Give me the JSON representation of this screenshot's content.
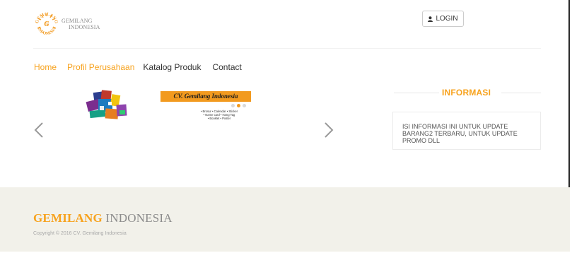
{
  "header": {
    "logo": {
      "name_line1": "GEMILANG",
      "name_line2": "INDONESIA",
      "emblem_text_top": "GEMILANG",
      "emblem_text_bottom": "INDONESIA",
      "emblem_monogram": "G"
    },
    "login_label": "LOGIN",
    "login_icon": "user-icon"
  },
  "nav": {
    "items": [
      {
        "label": "Home",
        "active": true
      },
      {
        "label": "Profil Perusahaan",
        "active": true
      },
      {
        "label": "Katalog Produk",
        "active": false
      },
      {
        "label": "Contact",
        "active": false
      }
    ]
  },
  "carousel": {
    "slide": {
      "banner_text": "CV. Gemilang Indonesia",
      "dots_total": 3,
      "active_dot": 2,
      "products": [
        "• Brosur  • Calendar  • Sticker",
        "• Name card  • Hang Tag",
        "• Booklet  • Poster"
      ]
    },
    "prev_icon": "chevron-left-icon",
    "next_icon": "chevron-right-icon"
  },
  "informasi": {
    "title": "INFORMASI",
    "text": "ISI INFORMASI INI UNTUK UPDATE BARANG2 TERBARU, UNTUK UPDATE PROMO DLL"
  },
  "footer": {
    "brand_part1": "GEMILANG",
    "brand_part2": "INDONESIA",
    "copyright": "Copyright © 2016 CV. Gemilang Indonesia"
  },
  "colors": {
    "accent": "#f7a21d",
    "footer_bg": "#f2f1ea",
    "text": "#333333",
    "muted": "#a8a8a8"
  }
}
